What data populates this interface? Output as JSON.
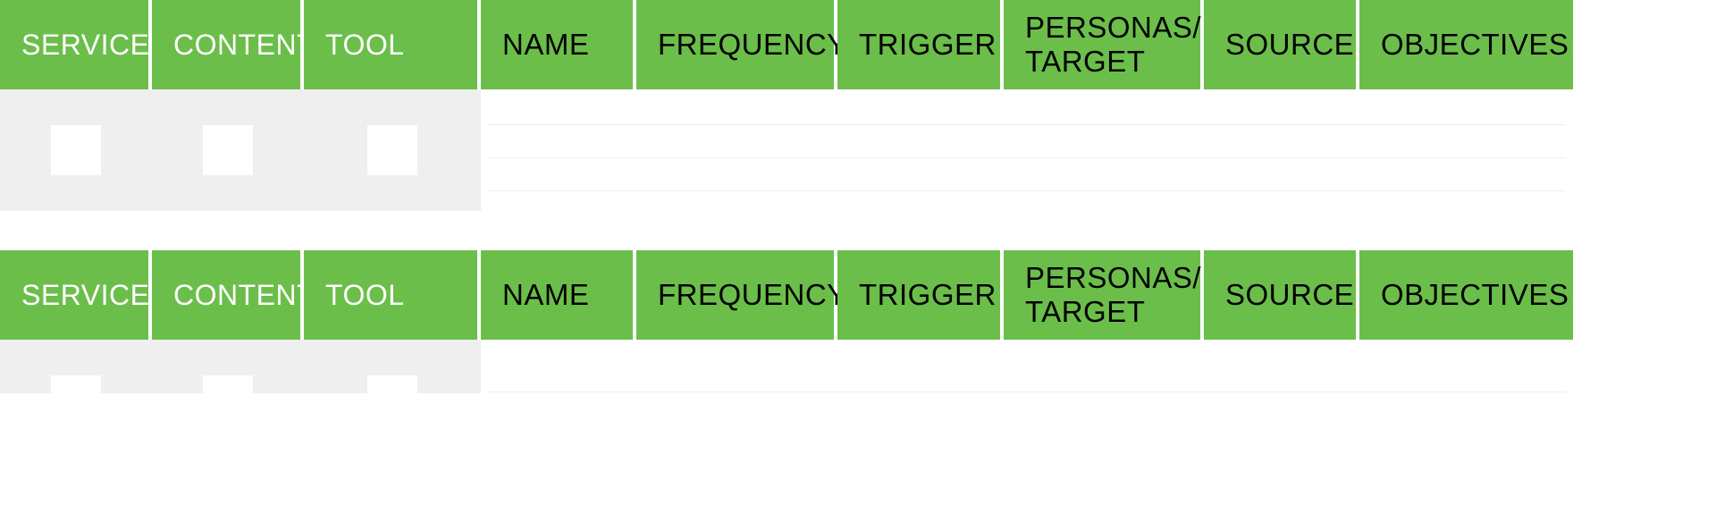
{
  "columns": {
    "service": "SERVICE",
    "content": "CONTENT",
    "tool": "TOOL",
    "name": "NAME",
    "frequency": "FREQUENCY",
    "trigger": "TRIGGER",
    "personas": "PERSONAS/ TARGET",
    "source": "SOURCE",
    "objectives": "OBJECTIVES"
  }
}
